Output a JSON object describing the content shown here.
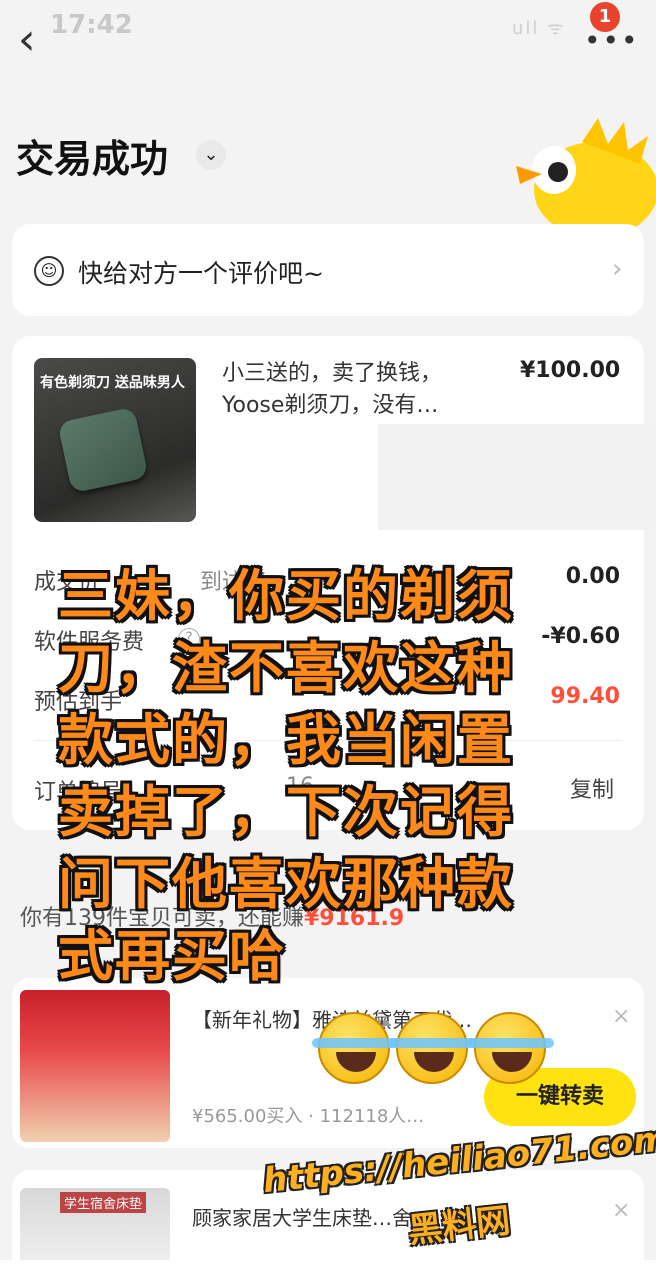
{
  "status_bar": {
    "time": "17:42",
    "signal": "ull  ᯤ"
  },
  "nav": {
    "back_glyph": "‹",
    "more_glyph": "•••",
    "badge_count": "1"
  },
  "header": {
    "title": "交易成功",
    "chevron": "⌄"
  },
  "review": {
    "text": "快给对方一个评价吧~",
    "icon": "☺",
    "arrow": "›"
  },
  "product": {
    "image_label": "有色剃须刀 送品味男人",
    "title": "小三送的，卖了换钱，Yoose剃须刀，没有…",
    "price": "¥100.00"
  },
  "order_rows": [
    {
      "label": "成交价",
      "partial": "到达您",
      "value": "0.00"
    },
    {
      "label": "软件服务费",
      "value": "-¥0.60"
    },
    {
      "label": "预估到手",
      "value": "99.40"
    }
  ],
  "order_number": {
    "label": "订单编号",
    "partial": "16",
    "copy_label": "复制"
  },
  "can_sell": {
    "prefix": "你有139件宝贝可卖，还能赚",
    "amount": "¥9161.9"
  },
  "recommendations": [
    {
      "title": "【新年礼物】雅诗兰黛第五代…",
      "sub": "¥565.00买入 · 112118人…",
      "img_label": "",
      "close": "×"
    },
    {
      "title": "顾家家居大学生床垫…舍…",
      "img_label": "学生宿舍床垫",
      "close": "×"
    }
  ],
  "resell_button": {
    "label": "一键转卖"
  },
  "overlay": {
    "caption_lines": [
      "三妹，你买的剃须",
      "刀，渣不喜欢这种",
      "款式的，我当闲置",
      "卖掉了，下次记得",
      "问下他喜欢那种款",
      "式再买哈"
    ]
  },
  "watermark": {
    "url": "https://heiliao71.com",
    "name": "黑料网"
  },
  "colors": {
    "accent": "#ffe20f",
    "price_red": "#ff4f3a",
    "caption": "#ff8a1a",
    "badge": "#e8432c"
  }
}
